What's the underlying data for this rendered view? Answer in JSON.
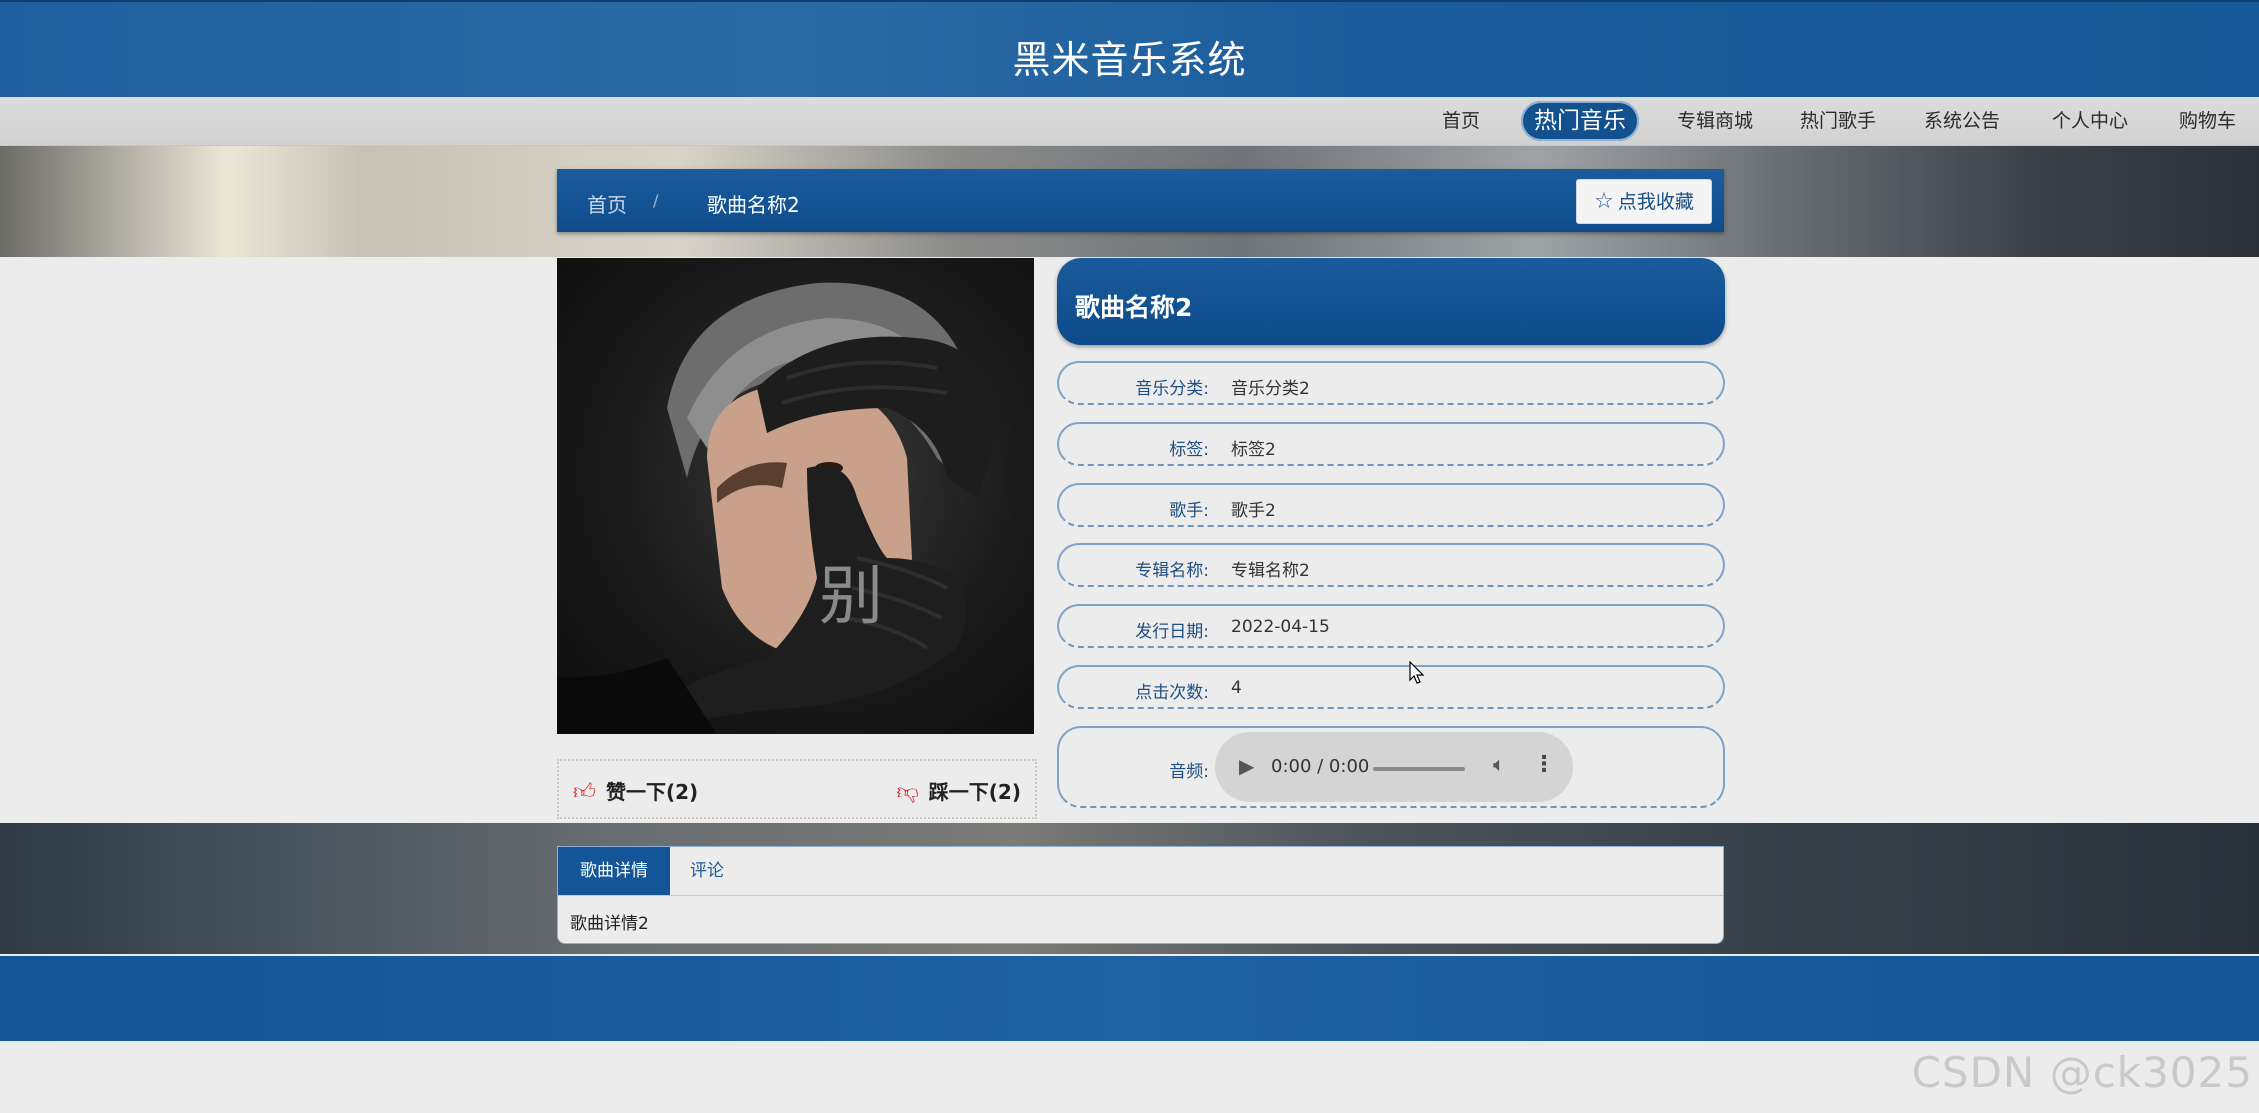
{
  "header": {
    "title": "黑米音乐系统"
  },
  "nav": {
    "items": [
      {
        "label": "首页",
        "active": false
      },
      {
        "label": "热门音乐",
        "active": true
      },
      {
        "label": "专辑商城",
        "active": false
      },
      {
        "label": "热门歌手",
        "active": false
      },
      {
        "label": "系统公告",
        "active": false
      },
      {
        "label": "个人中心",
        "active": false
      },
      {
        "label": "购物车",
        "active": false
      }
    ]
  },
  "breadcrumb": {
    "home": "首页",
    "separator": "/",
    "current": "歌曲名称2",
    "favorite_label": "点我收藏"
  },
  "cover": {
    "overlay_text": "别"
  },
  "votes": {
    "like_label": "赞一下(2)",
    "dislike_label": "踩一下(2)"
  },
  "song": {
    "title": "歌曲名称2",
    "fields": [
      {
        "label": "音乐分类:",
        "value": "音乐分类2"
      },
      {
        "label": "标签:",
        "value": "标签2"
      },
      {
        "label": "歌手:",
        "value": "歌手2"
      },
      {
        "label": "专辑名称:",
        "value": "专辑名称2"
      },
      {
        "label": "发行日期:",
        "value": "2022-04-15"
      },
      {
        "label": "点击次数:",
        "value": "4"
      }
    ],
    "audio_label": "音频:",
    "player_time": "0:00 / 0:00"
  },
  "tabs": {
    "items": [
      {
        "label": "歌曲详情",
        "active": true
      },
      {
        "label": "评论",
        "active": false
      }
    ],
    "content": "歌曲详情2"
  },
  "watermark": "CSDN @ck3025",
  "colors": {
    "primary": "#135597",
    "accent_red": "#d42a2a"
  },
  "icons": [
    "star-icon",
    "thumbs-up-icon",
    "thumbs-down-icon",
    "play-icon",
    "volume-icon",
    "more-vertical-icon",
    "cursor-icon"
  ]
}
